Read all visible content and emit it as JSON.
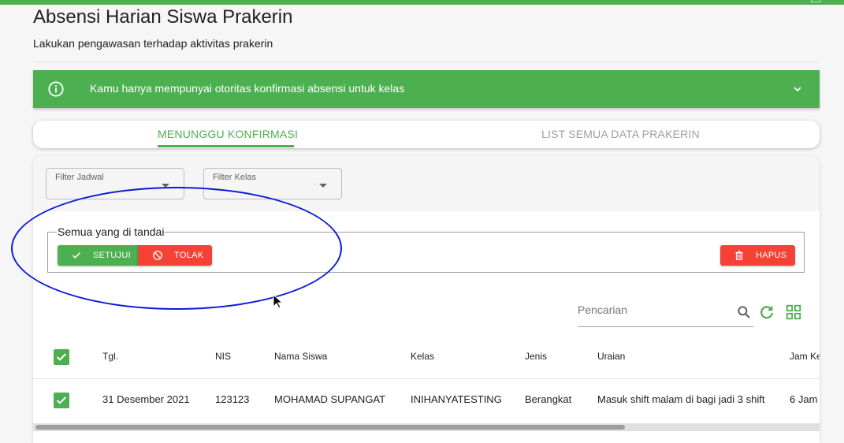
{
  "header": {
    "title": "Absensi Harian Siswa Prakerin",
    "subtitle": "Lakukan pengawasan terhadap aktivitas prakerin"
  },
  "alert": {
    "text": "Kamu hanya mempunyai otoritas konfirmasi absensi untuk kelas",
    "icon": "info-icon",
    "color": "#4caf50"
  },
  "tabs": [
    {
      "label": "MENUNGGU KONFIRMASI",
      "active": true
    },
    {
      "label": "LIST SEMUA DATA PRAKERIN",
      "active": false
    }
  ],
  "filters": {
    "jadwal_label": "Filter Jadwal",
    "kelas_label": "Filter Kelas"
  },
  "bulk": {
    "legend": "Semua yang di tandai",
    "approve_label": "SETUJUI",
    "reject_label": "TOLAK",
    "delete_label": "HAPUS"
  },
  "search": {
    "placeholder": "Pencarian"
  },
  "table": {
    "columns": [
      "Tgl.",
      "NIS",
      "Nama Siswa",
      "Kelas",
      "Jenis",
      "Uraian",
      "Jam Ke"
    ],
    "rows": [
      {
        "checked": true,
        "tgl": "31 Desember 2021",
        "nis": "123123",
        "nama": "MOHAMAD SUPANGAT",
        "kelas": "INIHANYATESTING",
        "jenis": "Berangkat",
        "uraian": "Masuk shift malam di bagi jadi 3 shift",
        "jam": "6 Jam"
      }
    ]
  },
  "colors": {
    "primary": "#4caf50",
    "danger": "#f44336",
    "annotation": "#0a1ad6"
  }
}
